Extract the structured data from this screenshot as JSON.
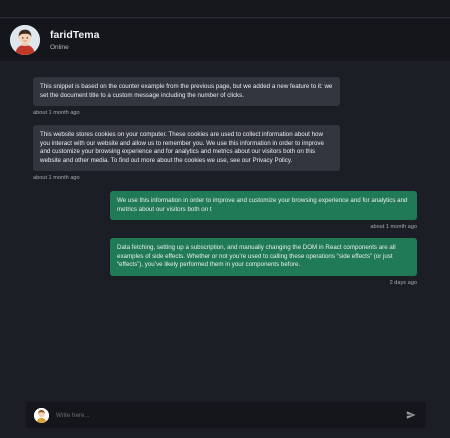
{
  "header": {
    "name": "faridTema",
    "status": "Online"
  },
  "messages": [
    {
      "direction": "in",
      "text": "This snippet is based on the counter example from the previous page, but we added a new feature to it: we set the document title to a custom message including the number of clicks.",
      "time": "about 1 month ago"
    },
    {
      "direction": "in",
      "text": "This website stores cookies on your computer. These cookies are used to collect information about how you interact with our website and allow us to remember you. We use this information in order to improve and customize your browsing experience and for analytics and metrics about our visitors both on this website and other media. To find out more about the cookies we use, see our Privacy Policy.",
      "time": "about 1 month ago"
    },
    {
      "direction": "out",
      "text": "We use this information in order to improve and customize your browsing experience and for analytics and metrics about our visitors both on t",
      "time": "about 1 month ago"
    },
    {
      "direction": "out",
      "text": "Data fetching, setting up a subscription, and manually changing the DOM in React components are all examples of side effects. Whether or not you’re used to calling these operations “side effects” (or just “effects”), you’ve likely performed them in your components before.",
      "time": "2 days ago"
    }
  ],
  "composer": {
    "placeholder": "Write here...",
    "send_icon": "send-icon"
  },
  "colors": {
    "background": "#1c1e26",
    "header": "#15161b",
    "incoming_bubble": "#33363f",
    "outgoing_bubble": "#1f7a55"
  }
}
